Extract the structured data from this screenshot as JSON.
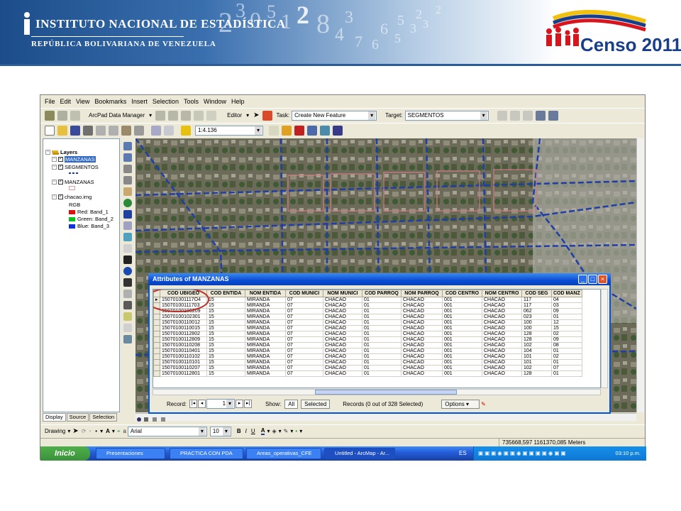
{
  "header": {
    "ine_line1": "INSTITUTO NACIONAL DE ESTADÍSTICA",
    "ine_line2": "REPÚBLICA BOLIVARIANA DE VENEZUELA",
    "censo_label": "Censo 2011",
    "digits": [
      "2",
      "3",
      "0",
      "5",
      "1",
      "2",
      "8",
      "4",
      "3",
      "7",
      "6",
      "5",
      "6",
      "5",
      "3",
      "2",
      "3",
      "2"
    ]
  },
  "menu": [
    "File",
    "Edit",
    "View",
    "Bookmarks",
    "Insert",
    "Selection",
    "Tools",
    "Window",
    "Help"
  ],
  "toolbar": {
    "arcpad_label": "ArcPad Data Manager",
    "editor_label": "Editor",
    "task_label": "Task:",
    "task_value": "Create New Feature",
    "target_label": "Target:",
    "target_value": "SEGMENTOS",
    "scale_value": "1:4.136"
  },
  "toc": {
    "root": "Layers",
    "layers": [
      {
        "name": "MANZANAS",
        "selected": true
      },
      {
        "name": "SEGMENTOS",
        "selected": false
      },
      {
        "name": "MANZANAS",
        "selected": false
      },
      {
        "name": "chacao.img",
        "selected": false
      }
    ],
    "rgb_label": "RGB",
    "bands": [
      {
        "label": "Red:",
        "band": "Band_1",
        "color": "#e01010"
      },
      {
        "label": "Green:",
        "band": "Band_2",
        "color": "#10c020"
      },
      {
        "label": "Blue:",
        "band": "Band_3",
        "color": "#1030e0"
      }
    ],
    "tabs": [
      "Display",
      "Source",
      "Selection"
    ]
  },
  "attr_table": {
    "title": "Attributes of MANZANAS",
    "columns": [
      "COD UBIGEO",
      "COD ENTIDA",
      "NOM ENTIDA",
      "COD MUNICI",
      "NOM MUNICI",
      "COD PARROQ",
      "NOM PARROQ",
      "COD CENTRO",
      "NOM CENTRO",
      "COD SEG",
      "COD MANZ"
    ],
    "rows": [
      [
        "150701001117O4",
        "15",
        "MIRANDA",
        "07",
        "CHACAO",
        "01",
        "CHACAO",
        "001",
        "CHACAO",
        "117",
        "04"
      ],
      [
        "15070100111703",
        "15",
        "MIRANDA",
        "07",
        "CHACAO",
        "01",
        "CHACAO",
        "001",
        "CHACAO",
        "117",
        "03"
      ],
      [
        "15070100106209",
        "15",
        "MIRANDA",
        "07",
        "CHACAO",
        "01",
        "CHACAO",
        "001",
        "CHACAO",
        "062",
        "09"
      ],
      [
        "15070100102301",
        "15",
        "MIRANDA",
        "07",
        "CHACAO",
        "01",
        "CHACAO",
        "001",
        "CHACAO",
        "023",
        "01"
      ],
      [
        "15070100110012",
        "15",
        "MIRANDA",
        "07",
        "CHACAO",
        "01",
        "CHACAO",
        "001",
        "CHACAO",
        "100",
        "12"
      ],
      [
        "15070100110015",
        "15",
        "MIRANDA",
        "07",
        "CHACAO",
        "01",
        "CHACAO",
        "001",
        "CHACAO",
        "100",
        "15"
      ],
      [
        "15070100112802",
        "15",
        "MIRANDA",
        "07",
        "CHACAO",
        "01",
        "CHACAO",
        "001",
        "CHACAO",
        "128",
        "02"
      ],
      [
        "15070100112809",
        "15",
        "MIRANDA",
        "07",
        "CHACAO",
        "01",
        "CHACAO",
        "001",
        "CHACAO",
        "128",
        "09"
      ],
      [
        "15070100110208",
        "15",
        "MIRANDA",
        "07",
        "CHACAO",
        "01",
        "CHACAO",
        "001",
        "CHACAO",
        "102",
        "08"
      ],
      [
        "15070100110401",
        "15",
        "MIRANDA",
        "07",
        "CHACAO",
        "01",
        "CHACAO",
        "001",
        "CHACAO",
        "104",
        "01"
      ],
      [
        "15070100110102",
        "15",
        "MIRANDA",
        "07",
        "CHACAO",
        "01",
        "CHACAO",
        "001",
        "CHACAO",
        "101",
        "02"
      ],
      [
        "15070100110101",
        "15",
        "MIRANDA",
        "07",
        "CHACAO",
        "01",
        "CHACAO",
        "001",
        "CHACAO",
        "101",
        "01"
      ],
      [
        "15070100110207",
        "15",
        "MIRANDA",
        "07",
        "CHACAO",
        "01",
        "CHACAO",
        "001",
        "CHACAO",
        "102",
        "07"
      ],
      [
        "15070100112801",
        "15",
        "MIRANDA",
        "07",
        "CHACAO",
        "01",
        "CHACAO",
        "001",
        "CHACAO",
        "128",
        "01"
      ]
    ],
    "record_label": "Record:",
    "record_value": "1",
    "show_label": "Show:",
    "all_label": "All",
    "selected_label": "Selected",
    "records_text": "Records (0 out of 328 Selected)",
    "options_label": "Options"
  },
  "drawbar": {
    "drawing_label": "Drawing",
    "font_value": "Arial",
    "size_value": "10",
    "bold": "B",
    "italic": "I",
    "underline": "U",
    "text_a": "A"
  },
  "status": {
    "coords": "735668,597  1161370,085 Meters"
  },
  "taskbar": {
    "start_label": "Inicio",
    "tasks": [
      "Presentaciones",
      "PRACTICA CON PDA",
      "Areas_operativas_CFE",
      "Untitled - ArcMap - Ar..."
    ],
    "lang": "ES",
    "clock": "03:10 p.m."
  }
}
